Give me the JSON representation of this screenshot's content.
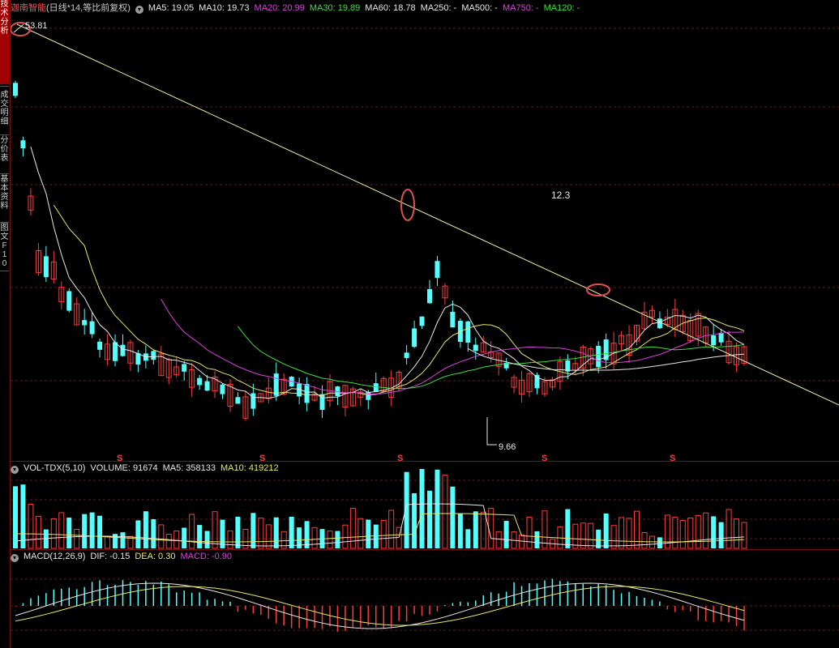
{
  "sidebar": {
    "tabs": [
      {
        "label": "技术分析",
        "active": true
      },
      {
        "label": "成交明细",
        "active": false
      },
      {
        "label": "分价表",
        "active": false
      },
      {
        "label": "基本资料",
        "active": false
      },
      {
        "label": "图文F10",
        "active": false
      }
    ]
  },
  "price_panel": {
    "stock_name": "迦南智能",
    "period_label": "(日线*14,等比前复权)",
    "ma": [
      {
        "label": "MA5: 19.05",
        "color": "#e8e8e8"
      },
      {
        "label": "MA10: 19.73",
        "color": "#e8e8e8"
      },
      {
        "label": "MA20: 20.99",
        "color": "#e040e0"
      },
      {
        "label": "MA30: 19.89",
        "color": "#40e040"
      },
      {
        "label": "MA60: 18.78",
        "color": "#e8e8e8"
      },
      {
        "label": "MA250: -",
        "color": "#e8e8e8"
      },
      {
        "label": "MA500: -",
        "color": "#e8e8e8"
      },
      {
        "label": "MA750: -",
        "color": "#e040e0"
      },
      {
        "label": "MA120: -",
        "color": "#40e040"
      }
    ],
    "high_label": "53.81",
    "low_label": "9.66",
    "annotation": "12.3",
    "s_marker": "S"
  },
  "volume_panel": {
    "title": "VOL-TDX(5,10)",
    "volume": "VOLUME: 91674",
    "ma5": "MA5: 358133",
    "ma10": "MA10: 419212"
  },
  "macd_panel": {
    "title": "MACD(12,26,9)",
    "dif": "DIF: -0.15",
    "dea": "DEA: 0.30",
    "macd": "MACD: -0.90"
  },
  "colors": {
    "up": "#ff3c3c",
    "down": "#54ffff",
    "ma_white": "#e8e8e8",
    "ma_yellow": "#e8e86a",
    "ma_magenta": "#e040e0",
    "ma_green": "#40e040",
    "trendline": "#f0f0a0",
    "grid": "#7a1010"
  }
}
